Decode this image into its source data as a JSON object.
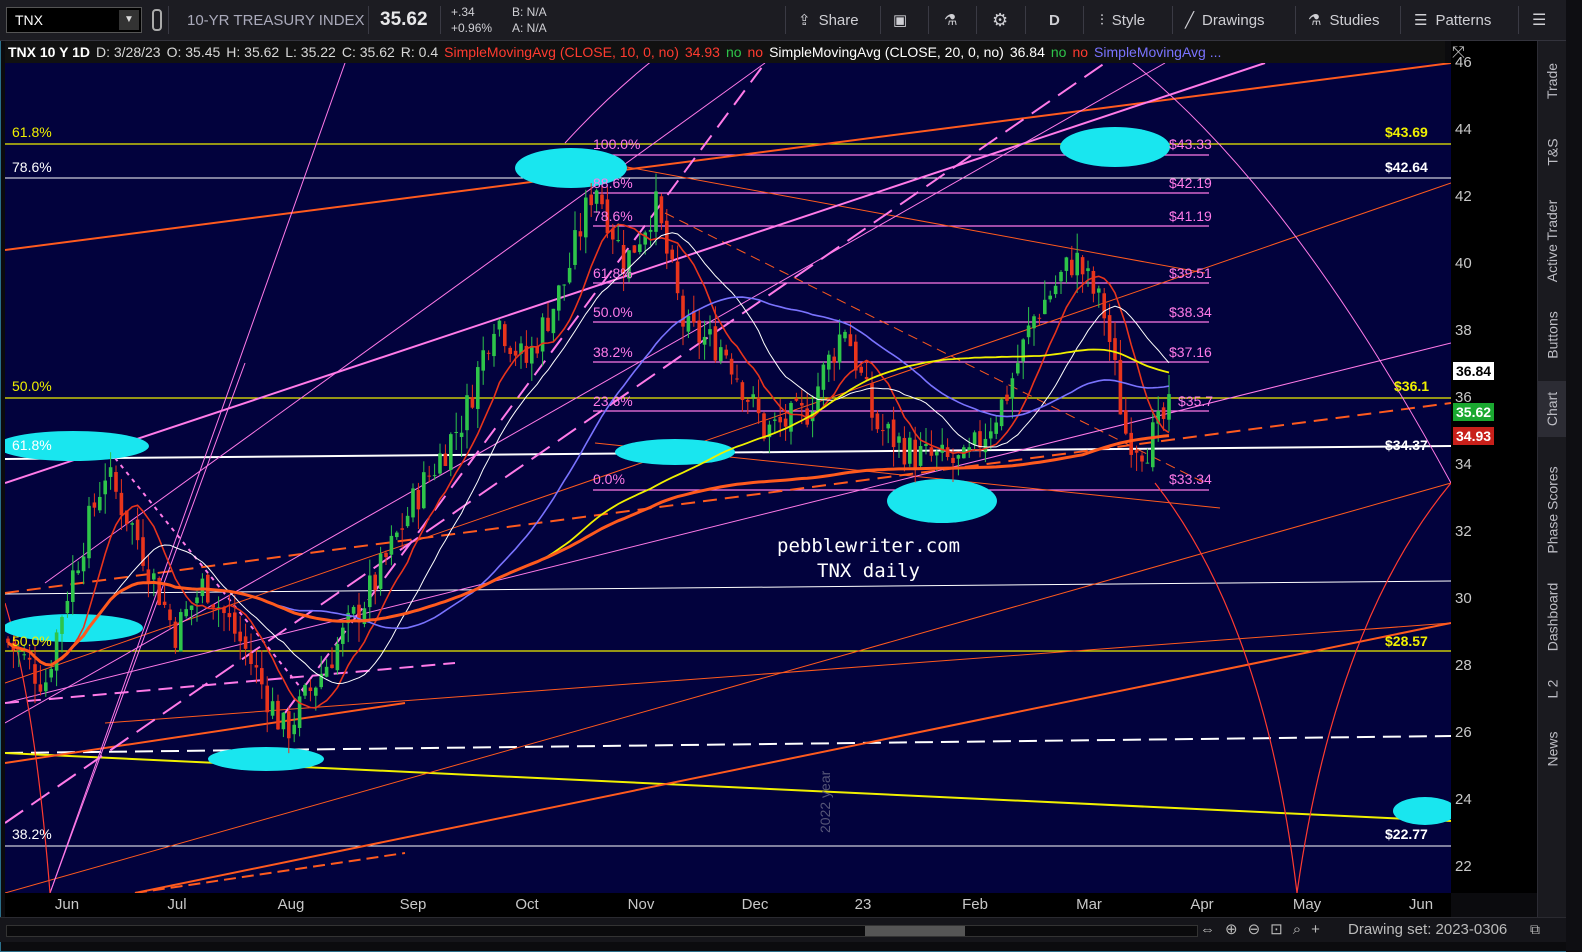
{
  "toolbar": {
    "symbol": "TNX",
    "description": "10-YR TREASURY INDEX",
    "last": "35.62",
    "change": "+.34",
    "change_pct": "+0.96%",
    "bid": "B: N/A",
    "ask": "A: N/A",
    "share": "Share",
    "period": "D",
    "style": "Style",
    "drawings": "Drawings",
    "studies": "Studies",
    "patterns": "Patterns"
  },
  "legend": {
    "symbol": "TNX 10 Y 1D",
    "date": "D: 3/28/23",
    "open": "O: 35.45",
    "high": "H: 35.62",
    "low": "L: 35.22",
    "close": "C: 35.62",
    "range": "R: 0.4",
    "sma10": "SimpleMovingAvg (CLOSE, 10, 0, no)",
    "sma10_val": "34.93",
    "no1": "no",
    "no2": "no",
    "sma20": "SimpleMovingAvg (CLOSE, 20, 0, no)",
    "sma20_val": "36.84",
    "no3": "no",
    "no4": "no",
    "sma3": "SimpleMovingAvg ..."
  },
  "yaxis": {
    "ticks": [
      "46",
      "44",
      "42",
      "40",
      "38",
      "36",
      "34",
      "32",
      "30",
      "28",
      "26",
      "24",
      "22"
    ],
    "tag_sma20": "36.84",
    "tag_last": "35.62",
    "tag_sma10": "34.93"
  },
  "xaxis": {
    "ticks": [
      "Jun",
      "Jul",
      "Aug",
      "Sep",
      "Oct",
      "Nov",
      "Dec",
      "23",
      "Feb",
      "Mar",
      "Apr",
      "May",
      "Jun"
    ]
  },
  "annotations": {
    "site": "pebblewriter.com",
    "caption": "TNX daily",
    "year_label": "2022 year",
    "fib_left": [
      "61.8%",
      "78.6%",
      "50.0%",
      "61.8%",
      "50.0%",
      "38.2%"
    ],
    "fib_right": [
      "$43.69",
      "$42.64",
      "$36.1",
      "$34.37",
      "$28.57",
      "$22.77"
    ],
    "fib_mid_pct": [
      "100.0%",
      "88.6%",
      "78.6%",
      "61.8%",
      "50.0%",
      "38.2%",
      "23.6%",
      "0.0%"
    ],
    "fib_mid_val": [
      "$43.33",
      "$42.19",
      "$41.19",
      "$39.51",
      "$38.34",
      "$37.16",
      "$35.7",
      "$33.34"
    ]
  },
  "sidebar": [
    "Trade",
    "T&S",
    "Active Trader",
    "Buttons",
    "Chart",
    "Phase Scores",
    "Dashboard",
    "L 2",
    "News"
  ],
  "bottombar": {
    "drawing_set": "Drawing set: 2023-0306"
  },
  "colors": {
    "chart_bg": "#02023d",
    "up": "#2ec44a",
    "down": "#e8341c",
    "sma10": "#e8341c",
    "sma20": "#ffffff",
    "sma50": "#7a73ff",
    "sma100": "#f0f000",
    "sma200": "#ff5a1e",
    "fib": "#ff7ae8",
    "ellipse": "#19e6ef"
  }
}
